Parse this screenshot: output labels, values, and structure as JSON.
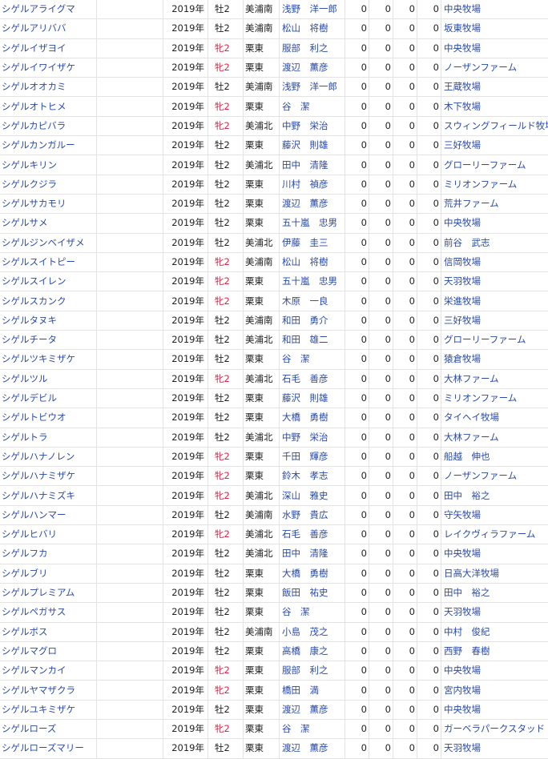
{
  "columns": [
    "name",
    "blank",
    "year",
    "sex",
    "area",
    "trainer",
    "n1",
    "n2",
    "n3",
    "n4",
    "breeder"
  ],
  "rows": [
    {
      "name": "シゲルアライグマ",
      "year": "2019年",
      "sex": "牡2",
      "female": false,
      "area": "美浦南",
      "trainer": "浅野　洋一郎",
      "n1": "0",
      "n2": "0",
      "n3": "0",
      "n4": "0",
      "breeder": "中央牧場"
    },
    {
      "name": "シゲルアリババ",
      "year": "2019年",
      "sex": "牡2",
      "female": false,
      "area": "美浦南",
      "trainer": "松山　将樹",
      "n1": "0",
      "n2": "0",
      "n3": "0",
      "n4": "0",
      "breeder": "坂東牧場"
    },
    {
      "name": "シゲルイザヨイ",
      "year": "2019年",
      "sex": "牝2",
      "female": true,
      "area": "栗東",
      "trainer": "服部　利之",
      "n1": "0",
      "n2": "0",
      "n3": "0",
      "n4": "0",
      "breeder": "中央牧場"
    },
    {
      "name": "シゲルイワイザケ",
      "year": "2019年",
      "sex": "牝2",
      "female": true,
      "area": "栗東",
      "trainer": "渡辺　薫彦",
      "n1": "0",
      "n2": "0",
      "n3": "0",
      "n4": "0",
      "breeder": "ノーザンファーム"
    },
    {
      "name": "シゲルオオカミ",
      "year": "2019年",
      "sex": "牡2",
      "female": false,
      "area": "美浦南",
      "trainer": "浅野　洋一郎",
      "n1": "0",
      "n2": "0",
      "n3": "0",
      "n4": "0",
      "breeder": "王蔵牧場"
    },
    {
      "name": "シゲルオトヒメ",
      "year": "2019年",
      "sex": "牝2",
      "female": true,
      "area": "栗東",
      "trainer": "谷　潔",
      "n1": "0",
      "n2": "0",
      "n3": "0",
      "n4": "0",
      "breeder": "木下牧場"
    },
    {
      "name": "シゲルカピバラ",
      "year": "2019年",
      "sex": "牝2",
      "female": true,
      "area": "美浦北",
      "trainer": "中野　栄治",
      "n1": "0",
      "n2": "0",
      "n3": "0",
      "n4": "0",
      "breeder": "スウィングフィールド牧場"
    },
    {
      "name": "シゲルカンガルー",
      "year": "2019年",
      "sex": "牡2",
      "female": false,
      "area": "栗東",
      "trainer": "藤沢　則雄",
      "n1": "0",
      "n2": "0",
      "n3": "0",
      "n4": "0",
      "breeder": "三好牧場"
    },
    {
      "name": "シゲルキリン",
      "year": "2019年",
      "sex": "牡2",
      "female": false,
      "area": "美浦北",
      "trainer": "田中　清隆",
      "n1": "0",
      "n2": "0",
      "n3": "0",
      "n4": "0",
      "breeder": "グローリーファーム"
    },
    {
      "name": "シゲルクジラ",
      "year": "2019年",
      "sex": "牡2",
      "female": false,
      "area": "栗東",
      "trainer": "川村　禎彦",
      "n1": "0",
      "n2": "0",
      "n3": "0",
      "n4": "0",
      "breeder": "ミリオンファーム"
    },
    {
      "name": "シゲルサカモリ",
      "year": "2019年",
      "sex": "牡2",
      "female": false,
      "area": "栗東",
      "trainer": "渡辺　薫彦",
      "n1": "0",
      "n2": "0",
      "n3": "0",
      "n4": "0",
      "breeder": "荒井ファーム"
    },
    {
      "name": "シゲルサメ",
      "year": "2019年",
      "sex": "牡2",
      "female": false,
      "area": "栗東",
      "trainer": "五十嵐　忠男",
      "n1": "0",
      "n2": "0",
      "n3": "0",
      "n4": "0",
      "breeder": "中央牧場"
    },
    {
      "name": "シゲルジンベイザメ",
      "year": "2019年",
      "sex": "牡2",
      "female": false,
      "area": "美浦北",
      "trainer": "伊藤　圭三",
      "n1": "0",
      "n2": "0",
      "n3": "0",
      "n4": "0",
      "breeder": "前谷　武志"
    },
    {
      "name": "シゲルスイトピー",
      "year": "2019年",
      "sex": "牝2",
      "female": true,
      "area": "美浦南",
      "trainer": "松山　将樹",
      "n1": "0",
      "n2": "0",
      "n3": "0",
      "n4": "0",
      "breeder": "信岡牧場"
    },
    {
      "name": "シゲルスイレン",
      "year": "2019年",
      "sex": "牝2",
      "female": true,
      "area": "栗東",
      "trainer": "五十嵐　忠男",
      "n1": "0",
      "n2": "0",
      "n3": "0",
      "n4": "0",
      "breeder": "天羽牧場"
    },
    {
      "name": "シゲルスカンク",
      "year": "2019年",
      "sex": "牝2",
      "female": true,
      "area": "栗東",
      "trainer": "木原　一良",
      "n1": "0",
      "n2": "0",
      "n3": "0",
      "n4": "0",
      "breeder": "栄進牧場"
    },
    {
      "name": "シゲルタヌキ",
      "year": "2019年",
      "sex": "牡2",
      "female": false,
      "area": "美浦南",
      "trainer": "和田　勇介",
      "n1": "0",
      "n2": "0",
      "n3": "0",
      "n4": "0",
      "breeder": "三好牧場"
    },
    {
      "name": "シゲルチータ",
      "year": "2019年",
      "sex": "牡2",
      "female": false,
      "area": "美浦北",
      "trainer": "和田　雄二",
      "n1": "0",
      "n2": "0",
      "n3": "0",
      "n4": "0",
      "breeder": "グローリーファーム"
    },
    {
      "name": "シゲルツキミザケ",
      "year": "2019年",
      "sex": "牡2",
      "female": false,
      "area": "栗東",
      "trainer": "谷　潔",
      "n1": "0",
      "n2": "0",
      "n3": "0",
      "n4": "0",
      "breeder": "猿倉牧場"
    },
    {
      "name": "シゲルツル",
      "year": "2019年",
      "sex": "牝2",
      "female": true,
      "area": "美浦北",
      "trainer": "石毛　善彦",
      "n1": "0",
      "n2": "0",
      "n3": "0",
      "n4": "0",
      "breeder": "大林ファーム"
    },
    {
      "name": "シゲルデビル",
      "year": "2019年",
      "sex": "牡2",
      "female": false,
      "area": "栗東",
      "trainer": "藤沢　則雄",
      "n1": "0",
      "n2": "0",
      "n3": "0",
      "n4": "0",
      "breeder": "ミリオンファーム"
    },
    {
      "name": "シゲルトビウオ",
      "year": "2019年",
      "sex": "牡2",
      "female": false,
      "area": "栗東",
      "trainer": "大橋　勇樹",
      "n1": "0",
      "n2": "0",
      "n3": "0",
      "n4": "0",
      "breeder": "タイヘイ牧場"
    },
    {
      "name": "シゲルトラ",
      "year": "2019年",
      "sex": "牡2",
      "female": false,
      "area": "美浦北",
      "trainer": "中野　栄治",
      "n1": "0",
      "n2": "0",
      "n3": "0",
      "n4": "0",
      "breeder": "大林ファーム"
    },
    {
      "name": "シゲルハナノレン",
      "year": "2019年",
      "sex": "牝2",
      "female": true,
      "area": "栗東",
      "trainer": "千田　輝彦",
      "n1": "0",
      "n2": "0",
      "n3": "0",
      "n4": "0",
      "breeder": "船越　伸也"
    },
    {
      "name": "シゲルハナミザケ",
      "year": "2019年",
      "sex": "牝2",
      "female": true,
      "area": "栗東",
      "trainer": "鈴木　孝志",
      "n1": "0",
      "n2": "0",
      "n3": "0",
      "n4": "0",
      "breeder": "ノーザンファーム"
    },
    {
      "name": "シゲルハナミズキ",
      "year": "2019年",
      "sex": "牝2",
      "female": true,
      "area": "美浦北",
      "trainer": "深山　雅史",
      "n1": "0",
      "n2": "0",
      "n3": "0",
      "n4": "0",
      "breeder": "田中　裕之"
    },
    {
      "name": "シゲルハンマー",
      "year": "2019年",
      "sex": "牡2",
      "female": false,
      "area": "美浦南",
      "trainer": "水野　貴広",
      "n1": "0",
      "n2": "0",
      "n3": "0",
      "n4": "0",
      "breeder": "守矢牧場"
    },
    {
      "name": "シゲルヒバリ",
      "year": "2019年",
      "sex": "牝2",
      "female": true,
      "area": "美浦北",
      "trainer": "石毛　善彦",
      "n1": "0",
      "n2": "0",
      "n3": "0",
      "n4": "0",
      "breeder": "レイクヴィラファーム"
    },
    {
      "name": "シゲルフカ",
      "year": "2019年",
      "sex": "牡2",
      "female": false,
      "area": "美浦北",
      "trainer": "田中　清隆",
      "n1": "0",
      "n2": "0",
      "n3": "0",
      "n4": "0",
      "breeder": "中央牧場"
    },
    {
      "name": "シゲルブリ",
      "year": "2019年",
      "sex": "牡2",
      "female": false,
      "area": "栗東",
      "trainer": "大橋　勇樹",
      "n1": "0",
      "n2": "0",
      "n3": "0",
      "n4": "0",
      "breeder": "日高大洋牧場"
    },
    {
      "name": "シゲルプレミアム",
      "year": "2019年",
      "sex": "牡2",
      "female": false,
      "area": "栗東",
      "trainer": "飯田　祐史",
      "n1": "0",
      "n2": "0",
      "n3": "0",
      "n4": "0",
      "breeder": "田中　裕之"
    },
    {
      "name": "シゲルペガサス",
      "year": "2019年",
      "sex": "牡2",
      "female": false,
      "area": "栗東",
      "trainer": "谷　潔",
      "n1": "0",
      "n2": "0",
      "n3": "0",
      "n4": "0",
      "breeder": "天羽牧場"
    },
    {
      "name": "シゲルボス",
      "year": "2019年",
      "sex": "牡2",
      "female": false,
      "area": "美浦南",
      "trainer": "小島　茂之",
      "n1": "0",
      "n2": "0",
      "n3": "0",
      "n4": "0",
      "breeder": "中村　俊紀"
    },
    {
      "name": "シゲルマグロ",
      "year": "2019年",
      "sex": "牡2",
      "female": false,
      "area": "栗東",
      "trainer": "高橋　康之",
      "n1": "0",
      "n2": "0",
      "n3": "0",
      "n4": "0",
      "breeder": "西野　春樹"
    },
    {
      "name": "シゲルマンカイ",
      "year": "2019年",
      "sex": "牝2",
      "female": true,
      "area": "栗東",
      "trainer": "服部　利之",
      "n1": "0",
      "n2": "0",
      "n3": "0",
      "n4": "0",
      "breeder": "中央牧場"
    },
    {
      "name": "シゲルヤマザクラ",
      "year": "2019年",
      "sex": "牝2",
      "female": true,
      "area": "栗東",
      "trainer": "橋田　満",
      "n1": "0",
      "n2": "0",
      "n3": "0",
      "n4": "0",
      "breeder": "宮内牧場"
    },
    {
      "name": "シゲルユキミザケ",
      "year": "2019年",
      "sex": "牡2",
      "female": false,
      "area": "栗東",
      "trainer": "渡辺　薫彦",
      "n1": "0",
      "n2": "0",
      "n3": "0",
      "n4": "0",
      "breeder": "中央牧場"
    },
    {
      "name": "シゲルローズ",
      "year": "2019年",
      "sex": "牝2",
      "female": true,
      "area": "栗東",
      "trainer": "谷　潔",
      "n1": "0",
      "n2": "0",
      "n3": "0",
      "n4": "0",
      "breeder": "ガーベラパークスタッド"
    },
    {
      "name": "シゲルローズマリー",
      "year": "2019年",
      "sex": "牡2",
      "female": false,
      "area": "栗東",
      "trainer": "渡辺　薫彦",
      "n1": "0",
      "n2": "0",
      "n3": "0",
      "n4": "0",
      "breeder": "天羽牧場"
    }
  ]
}
